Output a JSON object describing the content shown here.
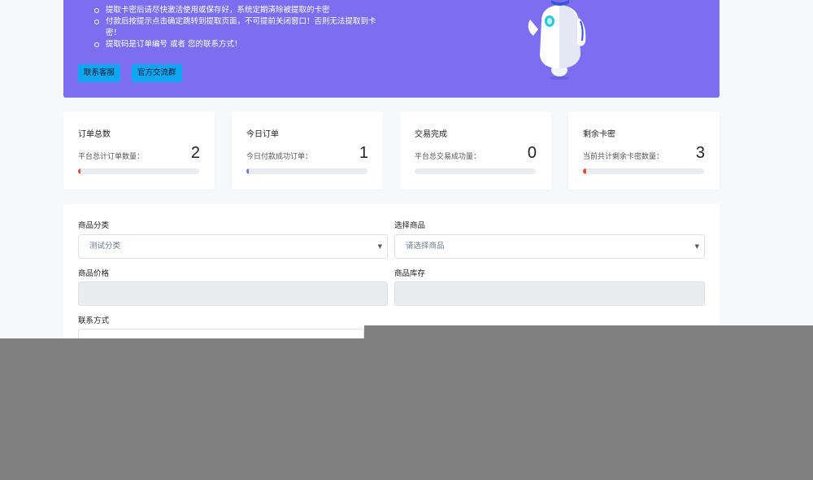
{
  "banner": {
    "notices": [
      "提取卡密后请尽快激活使用或保存好，系统定期清除被提取的卡密",
      "付款后按提示点击确定跳转到提取页面，不可提前关闭窗口！否则无法提取到卡密！",
      "提取码是订单编号 或者 您的联系方式！"
    ],
    "contact_service_label": "联系客服",
    "official_group_label": "官方交流群"
  },
  "stats": [
    {
      "title": "订单总数",
      "desc": "平台总计订单数量：",
      "value": "2",
      "progress": 0.02,
      "color": "#e74c3c"
    },
    {
      "title": "今日订单",
      "desc": "今日付款成功订单：",
      "value": "1",
      "progress": 0.01,
      "color": "#6c7ae0"
    },
    {
      "title": "交易完成",
      "desc": "平台总交易成功量：",
      "value": "0",
      "progress": 0.0,
      "color": "#27ae60"
    },
    {
      "title": "剩余卡密",
      "desc": "当前共计剩余卡密数量：",
      "value": "3",
      "progress": 0.03,
      "color": "#e74c3c"
    }
  ],
  "form": {
    "category_label": "商品分类",
    "category_value": "测试分类",
    "product_label": "选择商品",
    "product_placeholder": "请选择商品",
    "price_label": "商品价格",
    "stock_label": "商品库存",
    "contact_label": "联系方式"
  },
  "icons": {
    "caret": "chevron-down-icon",
    "robot": "robot-mascot-icon"
  }
}
